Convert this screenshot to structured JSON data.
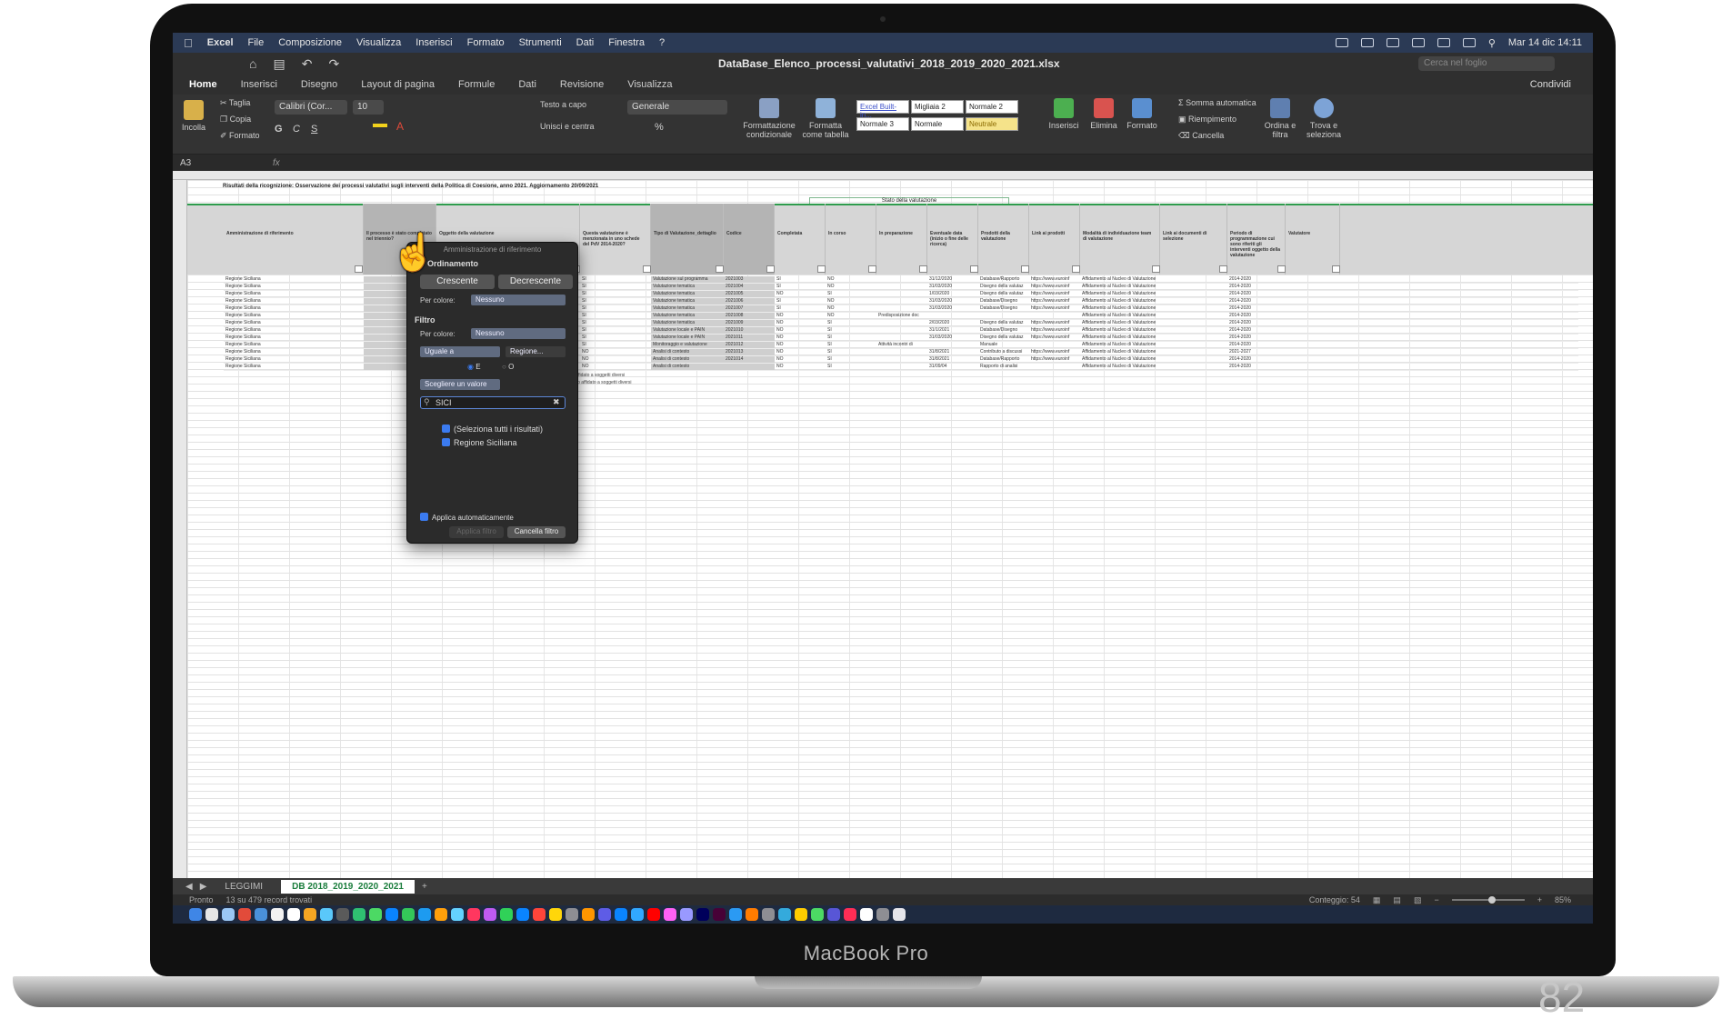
{
  "device": {
    "brand": "MacBook Pro",
    "slide_number": "82"
  },
  "menubar": {
    "items": [
      "Excel",
      "File",
      "Composizione",
      "Visualizza",
      "Inserisci",
      "Formato",
      "Strumenti",
      "Dati",
      "Finestra",
      "?"
    ],
    "datetime": "Mar 14 dic 14:11"
  },
  "titlebar": {
    "document": "DataBase_Elenco_processi_valutativi_2018_2019_2020_2021.xlsx",
    "search_placeholder": "Cerca nel foglio"
  },
  "ribbon": {
    "tabs": [
      "Home",
      "Inserisci",
      "Disegno",
      "Layout di pagina",
      "Formule",
      "Dati",
      "Revisione",
      "Visualizza"
    ],
    "active_tab": "Home",
    "share": "Condividi",
    "paste": "Incolla",
    "cut": "Taglia",
    "copy": "Copia",
    "format_painter": "Formato",
    "font_name": "Calibri (Cor...",
    "font_size": "10",
    "wrap_text": "Testo a capo",
    "merge_center": "Unisci e centra",
    "number_format": "Generale",
    "conditional_format": "Formattazione condizionale",
    "format_table": "Formatta come tabella",
    "styles": [
      "Excel Built-in...",
      "Migliaia 2",
      "Normale 2",
      "Normale 3",
      "Normale",
      "Neutrale"
    ],
    "insert": "Inserisci",
    "delete": "Elimina",
    "format": "Formato",
    "autosum": "Somma automatica",
    "fill": "Riempimento",
    "clear": "Cancella",
    "sort_filter": "Ordina e filtra",
    "find_select": "Trova e seleziona"
  },
  "formulabar": {
    "namebox": "A3",
    "fx": "fx"
  },
  "sheet": {
    "title": "Risultati della ricognizione: Osservazione dei processi valutativi sugli interventi della Politica di Coesione, anno 2021. Aggiornamento 20/09/2021",
    "group_header": "Stato della valutazione",
    "columns": [
      "Amministrazione di riferimento",
      "Il processo è stato completato nel triennio?",
      "Oggetto della valutazione",
      "Questa valutazione è menzionata in uno schede del PdV 2014-2020?",
      "Tipo di Valutazione_dettaglio",
      "Codice",
      "Completata",
      "In corso",
      "In preparazione",
      "Eventuale data (inizio o fine delle ricerca)",
      "Prodotti della valutazione",
      "Link ai prodotti",
      "Modalità di individuazione team di valutazione",
      "Link ai documenti di selezione",
      "Periodo di programmazione cui sono riferiti gli interventi oggetto della valutazione",
      "Valutatore"
    ],
    "rows": [
      [
        "Regione Siciliana",
        "",
        "...e finanziarie di",
        "SI",
        "Valutazione sul programma",
        "2021003",
        "SI",
        "NO",
        "",
        "31/12/2020",
        "Database/Rapporto",
        "https://www.euroinf",
        "Affidamento al Nucleo di Valutazione",
        "",
        "2014-2020"
      ],
      [
        "Regione Siciliana",
        "",
        "...ontrasto di attuaz",
        "SI",
        "Valutazione tematica",
        "2021004",
        "SI",
        "NO",
        "",
        "31/03/2020",
        "Disegno della valutaz",
        "https://www.euroinf",
        "Affidamento al Nucleo di Valutazione",
        "",
        "2014-2020"
      ],
      [
        "Regione Siciliana",
        "",
        "...relativi all'Asse",
        "SI",
        "Valutazione tematica",
        "2021005",
        "NO",
        "SI",
        "",
        "1/03/2020",
        "Disegno della valutaz",
        "https://www.euroinf",
        "Affidamento al Nucleo di Valutazione",
        "",
        "2014-2020"
      ],
      [
        "Regione Siciliana",
        "",
        "...relativi all'Asse",
        "SI",
        "Valutazione tematica",
        "2021006",
        "SI",
        "NO",
        "",
        "31/03/2020",
        "Database/Disegno",
        "https://www.euroinf",
        "Affidamento al Nucleo di Valutazione",
        "",
        "2014-2020"
      ],
      [
        "Regione Siciliana",
        "",
        "...di supporto tt",
        "SI",
        "Valutazione tematica",
        "2021007",
        "SI",
        "NO",
        "",
        "31/03/2020",
        "Database/Disegno",
        "https://www.euroinf",
        "Affidamento al Nucleo di Valutazione",
        "",
        "2014-2020"
      ],
      [
        "Regione Siciliana",
        "",
        "...i termini di perfo",
        "SI",
        "Valutazione tematica",
        "2021008",
        "NO",
        "NO",
        "Predisposizione doc",
        "",
        "",
        "",
        "Affidamento al Nucleo di Valutazione",
        "",
        "2014-2020"
      ],
      [
        "Regione Siciliana",
        "",
        "...relativi all'Asse",
        "SI",
        "Valutazione tematica",
        "2021009",
        "NO",
        "SI",
        "",
        "2/03/2020",
        "Disegno della valutaz",
        "https://www.euroinf",
        "Affidamento al Nucleo di Valutazione",
        "",
        "2014-2020"
      ],
      [
        "Regione Siciliana",
        "",
        "...ati implementazio",
        "SI",
        "Valutazione locale e PAIN",
        "2021010",
        "NO",
        "SI",
        "",
        "31/1/2021",
        "Database/Disegno",
        "https://www.euroinf",
        "Affidamento al Nucleo di Valutazione",
        "",
        "2014-2020"
      ],
      [
        "Regione Siciliana",
        "",
        "...di supporto la",
        "SI",
        "Valutazione locale e PAIN",
        "2021011",
        "NO",
        "SI",
        "",
        "31/03/2020",
        "Disegno della valutaz",
        "https://www.euroinf",
        "Affidamento al Nucleo di Valutazione",
        "",
        "2014-2020"
      ],
      [
        "Regione Siciliana",
        "",
        "...ttuate per il PAR",
        "SI",
        "Monitoraggio e valutazione",
        "2021012",
        "NO",
        "SI",
        "Attività incontri di",
        "",
        "Manuale",
        "",
        "Affidamento al Nucleo di Valutazione",
        "",
        "2014-2020"
      ],
      [
        "Regione Siciliana",
        "",
        "...fase preliminare",
        "NO",
        "Analisi di contesto",
        "2021013",
        "NO",
        "SI",
        "",
        "31/8/2021",
        "Contributo a discussi",
        "https://www.euroinf",
        "Affidamento al Nucleo di Valutazione",
        "",
        "2021-2027"
      ],
      [
        "Regione Siciliana",
        "",
        "...fase funzionali si",
        "NO",
        "Analisi di contesto",
        "2021014",
        "NO",
        "SI",
        "",
        "31/8/2021",
        "Database/Rapporto",
        "https://www.euroinf",
        "Affidamento al Nucleo di Valutazione",
        "",
        "2014-2020"
      ],
      [
        "Regione Siciliana",
        "",
        "...papoli dei dati d",
        "NO",
        "Analisi di contesto",
        "",
        "NO",
        "SI",
        "",
        "31/09/04",
        "Rapporto di analisi",
        "",
        "Affidamento al Nucleo di Valutazione",
        "",
        "2014-2020"
      ]
    ],
    "notes": [
      "...o del tempo, il ciclo affidato a soggetti diversi",
      "...lena del tempo, a ciclo affidato a soggetti diversi"
    ]
  },
  "filter_popover": {
    "title": "Amministrazione di riferimento",
    "sort_label": "Ordinamento",
    "ascending": "Crescente",
    "descending": "Decrescente",
    "by_color_label": "Per colore:",
    "sort_color_value": "Nessuno",
    "filter_label": "Filtro",
    "filter_color_value": "Nessuno",
    "condition": "Uguale a",
    "condition_value": "Regione...",
    "and_label": "E",
    "or_label": "O",
    "choose_value": "Scegliere un valore",
    "search_value": "SICI",
    "select_all": "(Seleziona tutti i risultati)",
    "item": "Regione Siciliana",
    "auto_apply": "Applica automaticamente",
    "apply_button": "Applica filtro",
    "clear_button": "Cancella filtro"
  },
  "sheet_tabs": [
    "LEGGIMI",
    "DB 2018_2019_2020_2021"
  ],
  "active_sheet": "DB 2018_2019_2020_2021",
  "statusbar": {
    "ready": "Pronto",
    "records": "13 su 479 record trovati",
    "count": "Conteggio: 54",
    "zoom": "85%"
  },
  "colors": {
    "menubar": "#2b3a55",
    "accent_green": "#2e9c4d",
    "checkbox_blue": "#3b7bf0"
  }
}
